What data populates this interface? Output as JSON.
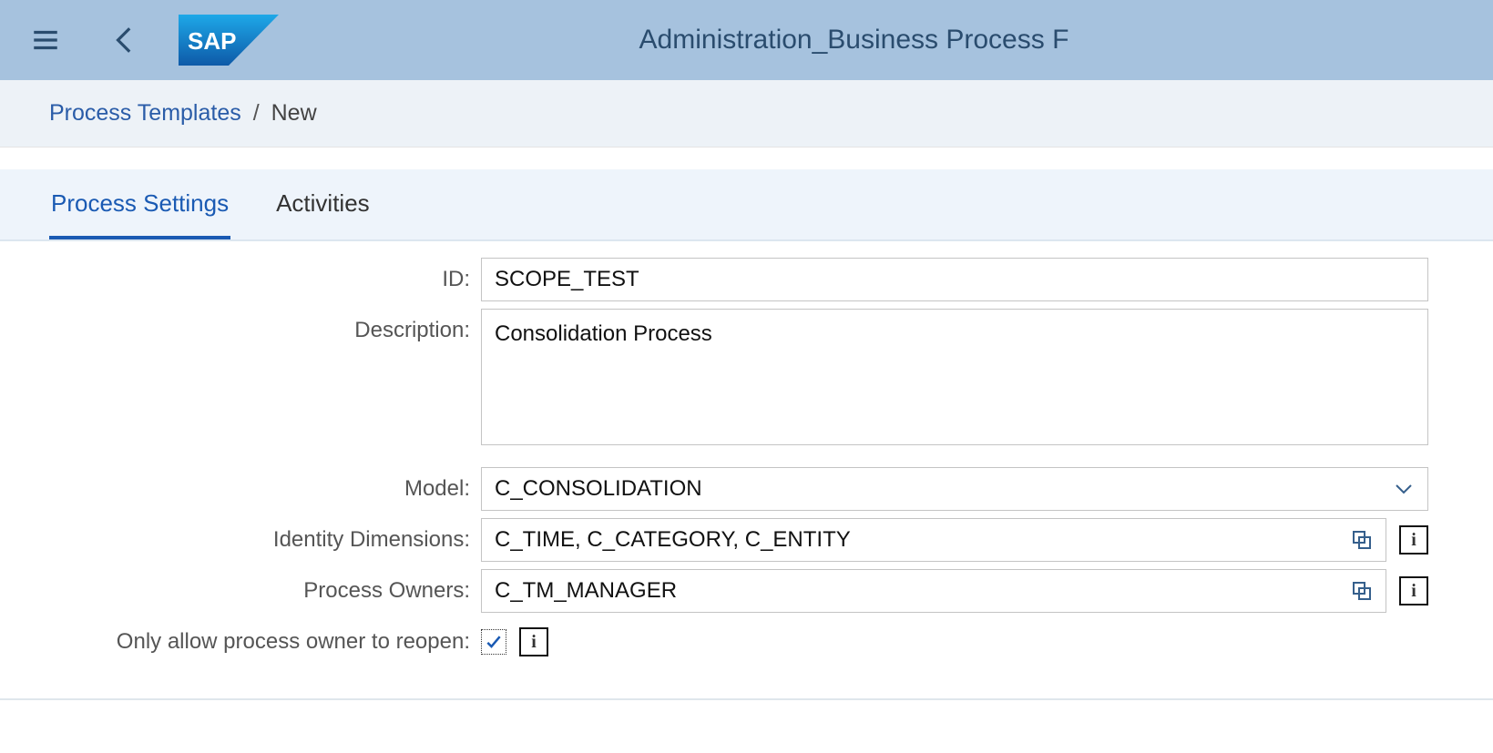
{
  "shell": {
    "title": "Administration_Business Process F"
  },
  "breadcrumb": {
    "link": "Process Templates",
    "separator": "/",
    "current": "New"
  },
  "tabs": {
    "settings": "Process Settings",
    "activities": "Activities"
  },
  "form": {
    "id_label": "ID:",
    "id_value": "SCOPE_TEST",
    "description_label": "Description:",
    "description_value": "Consolidation Process",
    "model_label": "Model:",
    "model_value": "C_CONSOLIDATION",
    "identity_dims_label": "Identity Dimensions:",
    "identity_dims_value": "C_TIME, C_CATEGORY, C_ENTITY",
    "owners_label": "Process Owners:",
    "owners_value": "C_TM_MANAGER",
    "reopen_label": "Only allow process owner to reopen:",
    "reopen_checked": true,
    "info_glyph": "i"
  }
}
